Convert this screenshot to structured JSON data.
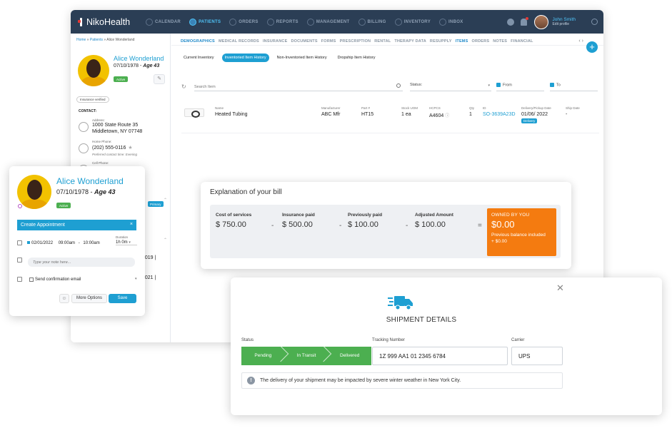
{
  "app": {
    "name": "NikoHealth"
  },
  "nav": [
    {
      "label": "CALENDAR",
      "icon": "calendar-icon"
    },
    {
      "label": "PATIENTS",
      "icon": "patients-icon",
      "active": true
    },
    {
      "label": "ORDERS",
      "icon": "orders-icon"
    },
    {
      "label": "REPORTS",
      "icon": "reports-icon"
    },
    {
      "label": "MANAGEMENT",
      "icon": "management-icon"
    },
    {
      "label": "BILLING",
      "icon": "billing-icon"
    },
    {
      "label": "INVENTORY",
      "icon": "inventory-icon"
    },
    {
      "label": "INBOX",
      "icon": "inbox-icon"
    }
  ],
  "user": {
    "name": "John Smith",
    "sub": "Edit profile"
  },
  "breadcrumb": {
    "home": "Home",
    "sep1": " » ",
    "patients": "Patients",
    "sep2": " » ",
    "current": "Alice Wonderland"
  },
  "patient": {
    "name": "Alice Wonderland",
    "dob": "07/10/1978 - ",
    "age": "Age 43",
    "status": "Active",
    "insurance": "Insurance verified",
    "contact_heading": "CONTACT:",
    "address_label": "Address:",
    "address_line1": "1000 State Route 35",
    "address_line2": "Middletown, NY 07748",
    "home_phone_label": "Home Phone:",
    "home_phone": "(202) 555-0116",
    "star": "★",
    "preferred": "Preferred contact time: Evening",
    "cell_label": "Cell Phone:",
    "primary": "Primary",
    "frag1": "2019 |",
    "frag2": "2021 |"
  },
  "tabs": [
    "DEMOGRAPHICS",
    "MEDICAL RECORDS",
    "INSURANCE",
    "DOCUMENTS",
    "FORMS",
    "PRESCRIPTION",
    "RENTAL",
    "THERAPY DATA",
    "RESUPPLY",
    "ITEMS",
    "ORDERS",
    "NOTES",
    "FINANCIAL"
  ],
  "tab_arrows": "‹  ›",
  "subtabs": [
    "Current Inventory",
    "Inventoried Item History",
    "Non-Inventoried Item History",
    "Dropship Item History"
  ],
  "filters": {
    "search_placeholder": "Search Item",
    "status": "Status:",
    "from": "From",
    "to": "To"
  },
  "item": {
    "name_label": "Name",
    "name": "Heated Tubing",
    "mfr_label": "Manufacturer",
    "mfr": "ABC Mfr",
    "part_label": "Part #",
    "part": "HT15",
    "uom_label": "Stock UOM",
    "uom": "1 ea",
    "hcpcs_label": "HCPCS",
    "hcpcs": "A4604",
    "qty_label": "Qty",
    "qty": "1",
    "id_label": "ID",
    "id": "SO-3639A23D",
    "delivery_label": "Delivery/Pickup Date",
    "delivery": "01/06/ 2022",
    "delivery_badge": "Delivery",
    "ship_label": "Ship Date",
    "ship": "-"
  },
  "bill": {
    "title": "Explanation of your bill",
    "cost_label": "Cost of services",
    "cost": "$ 750.00",
    "ins_label": "Insurance paid",
    "ins": "$ 500.00",
    "prev_label": "Previously paid",
    "prev": "$ 100.00",
    "adj_label": "Adjusted Amount",
    "adj": "$ 100.00",
    "minus": "-",
    "equals": "=",
    "owed_label": "OWNED BY YOU",
    "owed": "$0.00",
    "owed_note1": "Previous balance included",
    "owed_note2": "+ $0.00"
  },
  "shipment": {
    "title": "SHIPMENT DETAILS",
    "status_label": "Status",
    "steps": [
      "Pending",
      "In Transit",
      "Delivered"
    ],
    "tracking_label": "Tracking Number",
    "tracking": "1Z 999 AA1 01 2345 6784",
    "carrier_label": "Carrier",
    "carrier": "UPS",
    "alert": "The delivery of your shipment may be impacted by severe winter weather in New York City.",
    "alert_icon": "!",
    "close": "✕"
  },
  "appointment": {
    "name": "Alice Wonderland",
    "dob": "07/10/1978 - ",
    "age": "Age 43",
    "status": "Active",
    "create": "Create Appointment",
    "close": "×",
    "duration_label": "Duration",
    "date": "02/01/2022",
    "start": "09:00am",
    "dash": "-",
    "end": "10:00am",
    "duration": "1h 0m",
    "note_placeholder": "Type your note here...",
    "confirm": "Send confirmation email",
    "more": "More Options",
    "save": "Save",
    "emoji": "☺"
  },
  "colors": {
    "topbar": "#2b3e55",
    "accent": "#1e9fd2",
    "orange": "#f47b10",
    "green": "#4caf50"
  }
}
